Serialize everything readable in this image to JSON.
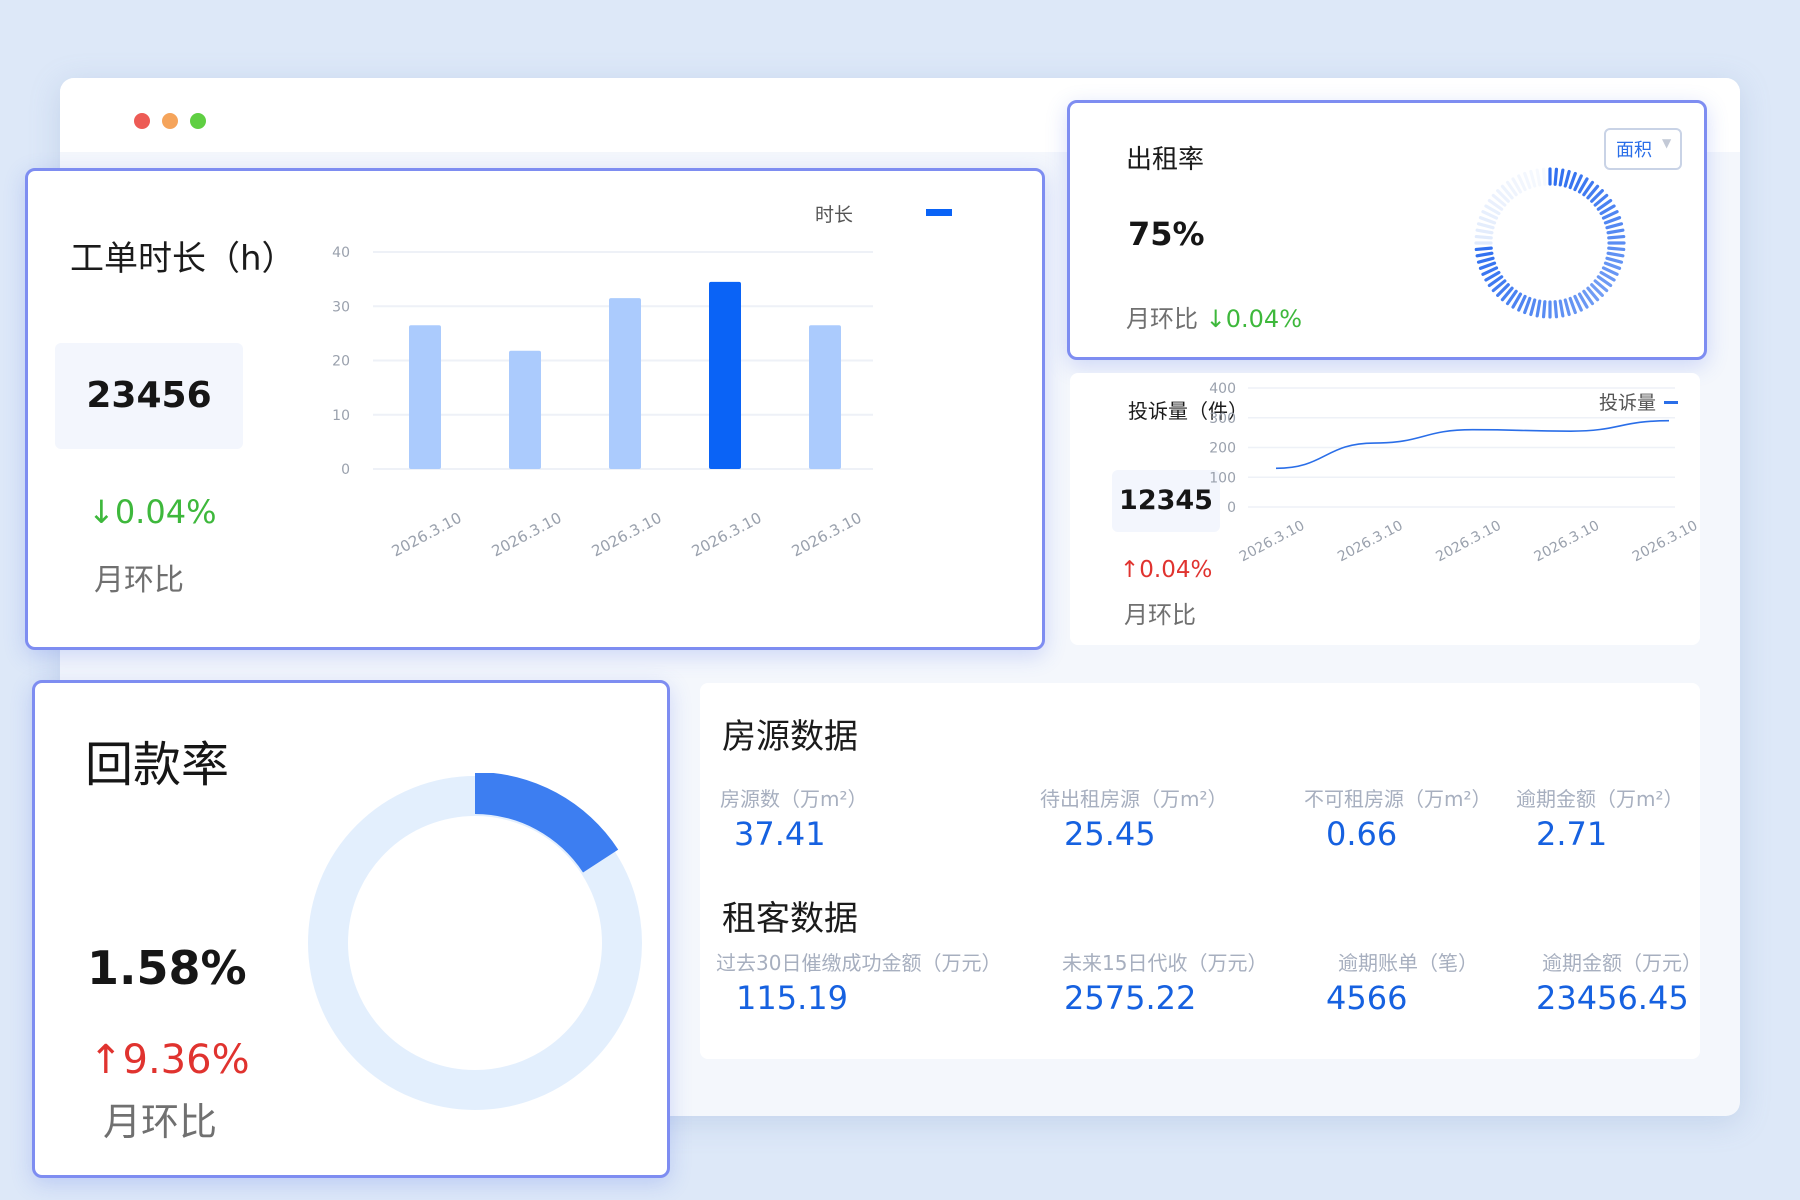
{
  "window": {
    "controls": [
      "close-dot",
      "minimize-dot",
      "maximize-dot"
    ],
    "control_colors": [
      "#ed5b55",
      "#f5a45b",
      "#5fcf42"
    ]
  },
  "work_order": {
    "title": "工单时长（h）",
    "total": "23456",
    "change": "0.04%",
    "change_arrow": "↓",
    "change_label": "月环比",
    "legend_label": "时长",
    "chart_data": {
      "type": "bar",
      "title": "工单时长（h）",
      "categories": [
        "2026.3.10",
        "2026.3.10",
        "2026.3.10",
        "2026.3.10",
        "2026.3.10"
      ],
      "values": [
        26.5,
        21.8,
        31.5,
        34.5,
        26.5
      ],
      "highlight_index": 3,
      "ylim": [
        0,
        40
      ],
      "yticks": [
        "0",
        "10",
        "20",
        "30",
        "40"
      ],
      "colors": {
        "normal": "#abcbfd",
        "highlight": "#0a63f6"
      },
      "legend": "top-right"
    }
  },
  "occupancy": {
    "title": "出租率",
    "value": "75%",
    "change_label": "月环比",
    "change_arrow": "↓",
    "change": "0.04%",
    "select_label": "面积",
    "gauge_fraction": 0.75
  },
  "complaints": {
    "title": "投诉量（件）",
    "total": "12345",
    "change_arrow": "↑",
    "change": "0.04%",
    "change_label": "月环比",
    "legend_label": "投诉量",
    "chart_data": {
      "type": "line",
      "title": "投诉量（件）",
      "x": [
        "2026.3.10",
        "2026.3.10",
        "2026.3.10",
        "2026.3.10",
        "2026.3.10"
      ],
      "series": [
        {
          "name": "投诉量",
          "values": [
            130,
            215,
            260,
            255,
            290
          ]
        }
      ],
      "ylim": [
        0,
        400
      ],
      "yticks": [
        "0",
        "100",
        "200",
        "300",
        "400"
      ],
      "color": "#2a6ee8",
      "legend": "top-right"
    }
  },
  "collection": {
    "title": "回款率",
    "value": "1.58%",
    "change_arrow": "↑",
    "change": "9.36%",
    "change_label": "月环比",
    "donut_fraction": 0.158,
    "colors": {
      "track": "#e3effd",
      "fill": "#3d7ef1"
    }
  },
  "property": {
    "title": "房源数据",
    "items": [
      {
        "label": "房源数（万m²）",
        "value": "37.41"
      },
      {
        "label": "待出租房源（万m²）",
        "value": "25.45"
      },
      {
        "label": "不可租房源（万m²）",
        "value": "0.66"
      },
      {
        "label": "逾期金额（万m²）",
        "value": "2.71"
      }
    ]
  },
  "tenant": {
    "title": "租客数据",
    "items": [
      {
        "label": "过去30日催缴成功金额（万元）",
        "value": "115.19"
      },
      {
        "label": "未来15日代收（万元）",
        "value": "2575.22"
      },
      {
        "label": "逾期账单（笔）",
        "value": "4566"
      },
      {
        "label": "逾期金额（万元）",
        "value": "23456.45"
      }
    ]
  }
}
